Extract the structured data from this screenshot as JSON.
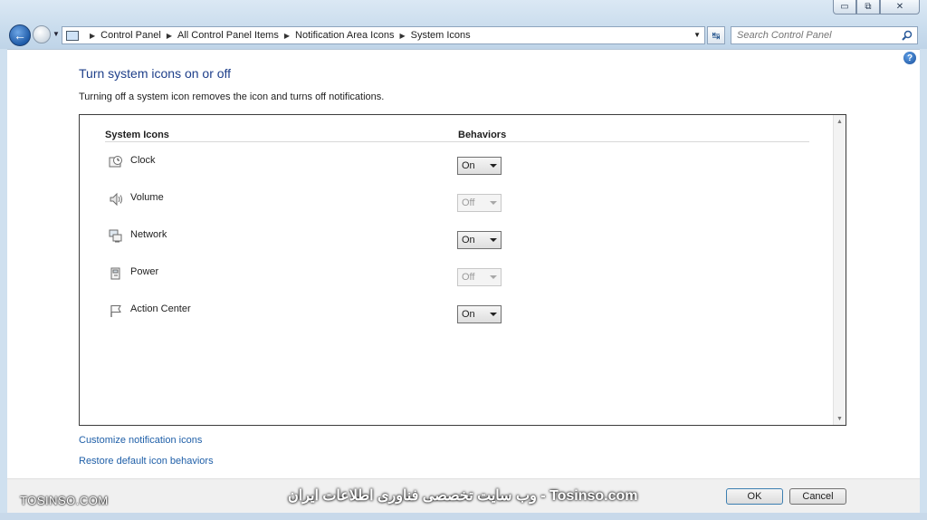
{
  "window": {
    "minimize_glyph": "▭",
    "maximize_glyph": "⧉",
    "close_glyph": "✕"
  },
  "address_bar": {
    "breadcrumbs": [
      "Control Panel",
      "All Control Panel Items",
      "Notification Area Icons",
      "System Icons"
    ]
  },
  "search": {
    "placeholder": "Search Control Panel"
  },
  "page": {
    "title": "Turn system icons on or off",
    "description": "Turning off a system icon removes the icon and turns off notifications."
  },
  "table": {
    "col_icons": "System Icons",
    "col_behaviors": "Behaviors",
    "rows": [
      {
        "label": "Clock",
        "icon": "clock-icon",
        "behavior": "On",
        "enabled": true
      },
      {
        "label": "Volume",
        "icon": "volume-icon",
        "behavior": "Off",
        "enabled": false
      },
      {
        "label": "Network",
        "icon": "network-icon",
        "behavior": "On",
        "enabled": true
      },
      {
        "label": "Power",
        "icon": "power-icon",
        "behavior": "Off",
        "enabled": false
      },
      {
        "label": "Action Center",
        "icon": "action-center-flag-icon",
        "behavior": "On",
        "enabled": true
      }
    ]
  },
  "links": {
    "customize": "Customize notification icons",
    "restore": "Restore default icon behaviors"
  },
  "buttons": {
    "ok": "OK",
    "cancel": "Cancel"
  },
  "watermark": {
    "left": "TOSINSO.COM",
    "center": "وب سایت تخصصی فناوری اطلاعات ایران - Tosinso.com"
  }
}
